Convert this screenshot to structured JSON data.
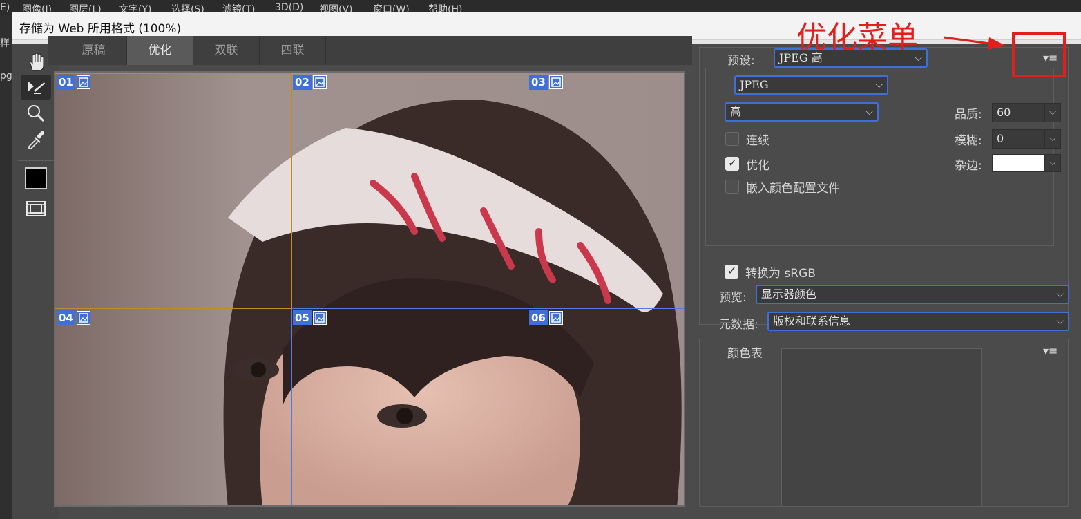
{
  "app_menubar": {
    "items": [
      "E)",
      "图像(I)",
      "图层(L)",
      "文字(Y)",
      "选择(S)",
      "滤镜(T)",
      "3D(D)",
      "视图(V)",
      "窗口(W)",
      "帮助(H)"
    ]
  },
  "left_strip": {
    "text_top": "样",
    "text_mid": "pg"
  },
  "dialog": {
    "title": "存储为 Web 所用格式 (100%)"
  },
  "tools": [
    {
      "name": "hand-tool",
      "icon": "hand-icon"
    },
    {
      "name": "slice-select-tool",
      "icon": "slice-select-icon"
    },
    {
      "name": "zoom-tool",
      "icon": "zoom-icon"
    },
    {
      "name": "eyedropper-tool",
      "icon": "eyedropper-icon"
    },
    {
      "name": "eyedropper-color",
      "icon": "color-swatch-icon",
      "color": "#000000"
    },
    {
      "name": "toggle-slices-visibility",
      "icon": "slices-visibility-icon"
    }
  ],
  "tabs": [
    "原稿",
    "优化",
    "双联",
    "四联"
  ],
  "active_tab": "优化",
  "slices": [
    "01",
    "02",
    "03",
    "04",
    "05",
    "06"
  ],
  "slice_colors": {
    "normal": "#4f7de0",
    "selected": "#c48a2a",
    "badge": "#3f6fd8"
  },
  "settings": {
    "preset_label": "预设:",
    "preset_value": "JPEG 高",
    "format_value": "JPEG",
    "quality_level": "高",
    "quality_label": "品质:",
    "quality_value": "60",
    "blur_label": "模糊:",
    "blur_value": "0",
    "matte_label": "杂边:",
    "matte_color": "#ffffff",
    "progressive_label": "连续",
    "progressive_checked": false,
    "optimized_label": "优化",
    "optimized_checked": true,
    "embed_profile_label": "嵌入颜色配置文件",
    "embed_profile_checked": false,
    "convert_srgb_label": "转换为 sRGB",
    "convert_srgb_checked": true,
    "preview_label": "预览:",
    "preview_value": "显示器颜色",
    "metadata_label": "元数据:",
    "metadata_value": "版权和联系信息",
    "chevron": "⌵"
  },
  "color_table": {
    "title": "颜色表"
  },
  "annotation": {
    "text": "优化菜单",
    "color": "#e0201d"
  }
}
